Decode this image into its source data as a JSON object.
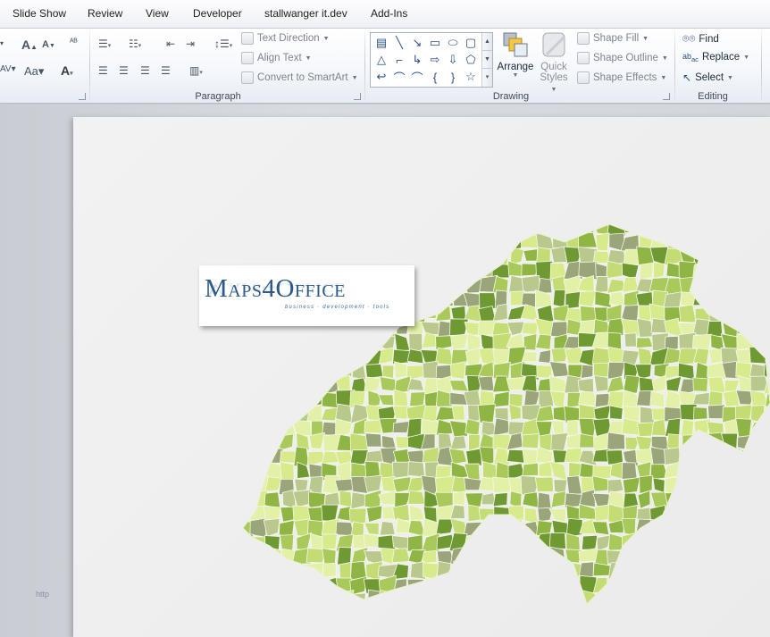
{
  "tabs": [
    "Slide Show",
    "Review",
    "View",
    "Developer",
    "stallwanger it.dev",
    "Add-Ins"
  ],
  "groups": {
    "paragraph": {
      "label": "Paragraph",
      "text_direction": "Text Direction",
      "align_text": "Align Text",
      "convert_smartart": "Convert to SmartArt"
    },
    "drawing": {
      "label": "Drawing",
      "arrange": "Arrange",
      "quick_styles_1": "Quick",
      "quick_styles_2": "Styles",
      "shape_fill": "Shape Fill",
      "shape_outline": "Shape Outline",
      "shape_effects": "Shape Effects"
    },
    "editing": {
      "label": "Editing",
      "find": "Find",
      "replace": "Replace",
      "select": "Select"
    }
  },
  "shapes_gallery": [
    "text-box-shape",
    "line-shape",
    "arrow-line-shape",
    "rectangle-shape",
    "oval-shape",
    "rounded-rectangle-shape",
    "triangle-shape",
    "elbow-connector-shape",
    "elbow-arrow-shape",
    "right-arrow-shape",
    "down-arrow-shape",
    "pentagon-shape",
    "curve-arrow-shape",
    "curved-connector-shape",
    "arc-shape",
    "left-brace-shape",
    "right-brace-shape",
    "star-shape"
  ],
  "slide": {
    "logo_title": "Maps4Office",
    "logo_tagline": "business · development · tools",
    "thumb_text": "http"
  },
  "colors": {
    "map_light": "#d7ea8c",
    "map_mid": "#a9c95a",
    "map_dark": "#6f9a33",
    "map_gray": "#9aa57a",
    "logo_blue": "#2c5a8a"
  }
}
